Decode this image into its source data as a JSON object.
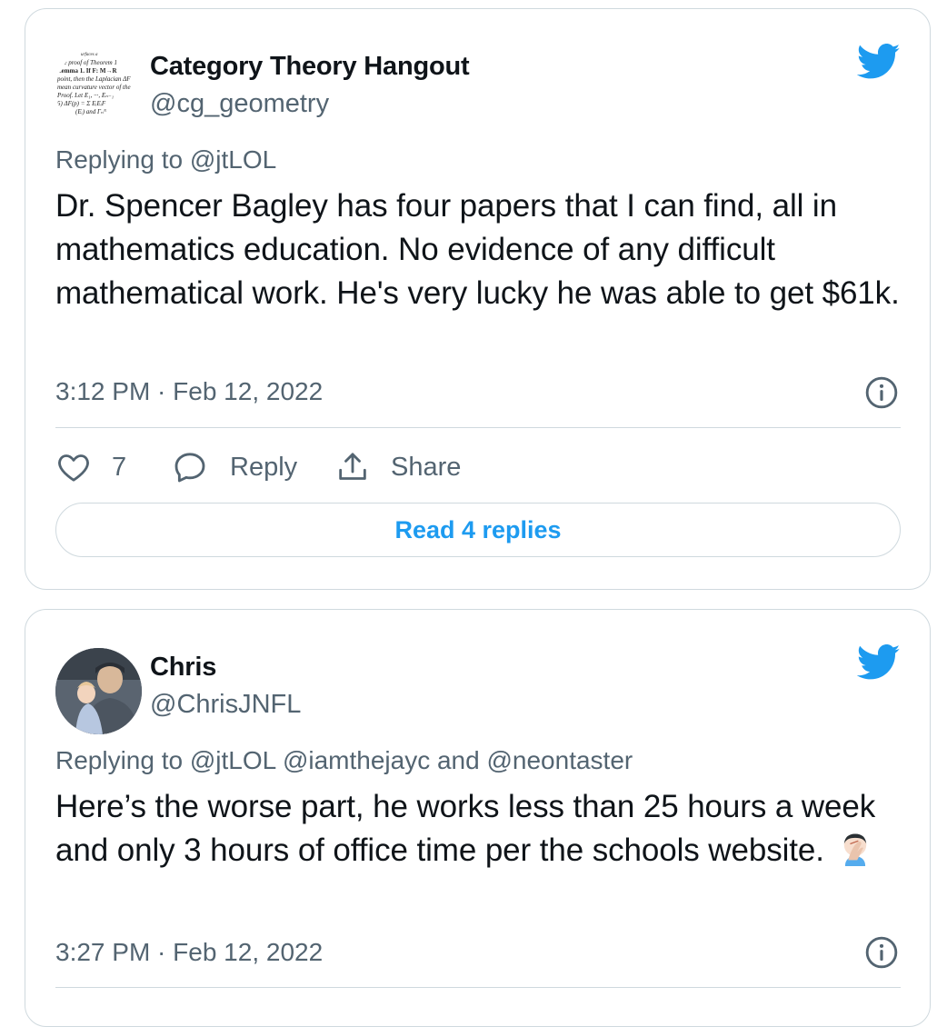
{
  "colors": {
    "twitter_blue": "#1d9bf0",
    "secondary_text": "#536471",
    "border": "#cfd9de"
  },
  "tweets": [
    {
      "display_name": "Category Theory Hangout",
      "handle": "@cg_geometry",
      "avatar": "math-paper-avatar",
      "avatar_text": [
        "urfaces a",
        "The proof of Theorem 1",
        "Lemma 1.  If F: M→R",
        "point, then the Laplacian ΔF",
        "mean curvature vector of the",
        "Proof.  Let E₁, ···, Eₙ₋₁",
        "5)    ΔF(p) = Σ EᵢEᵢF",
        "(Eᵢ) and Γₙᴺ"
      ],
      "replying_to": "Replying to @jtLOL",
      "text": "Dr. Spencer Bagley has four papers that I can find, all in mathematics education. No evidence of any difficult mathematical work. He's very lucky he was able to get $61k.",
      "timestamp": "3:12 PM · Feb 12, 2022",
      "likes": "7",
      "reply_label": "Reply",
      "share_label": "Share",
      "read_replies": "Read 4 replies"
    },
    {
      "display_name": "Chris",
      "handle": "@ChrisJNFL",
      "avatar": "user-photo-avatar",
      "replying_to": "Replying to @jtLOL @iamthejayc and @neontaster",
      "text": "Here’s the worse part, he works less than 25 hours a week and only 3 hours of office time per the schools website.",
      "emoji": "facepalm-emoji",
      "timestamp": "3:27 PM · Feb 12, 2022"
    }
  ]
}
